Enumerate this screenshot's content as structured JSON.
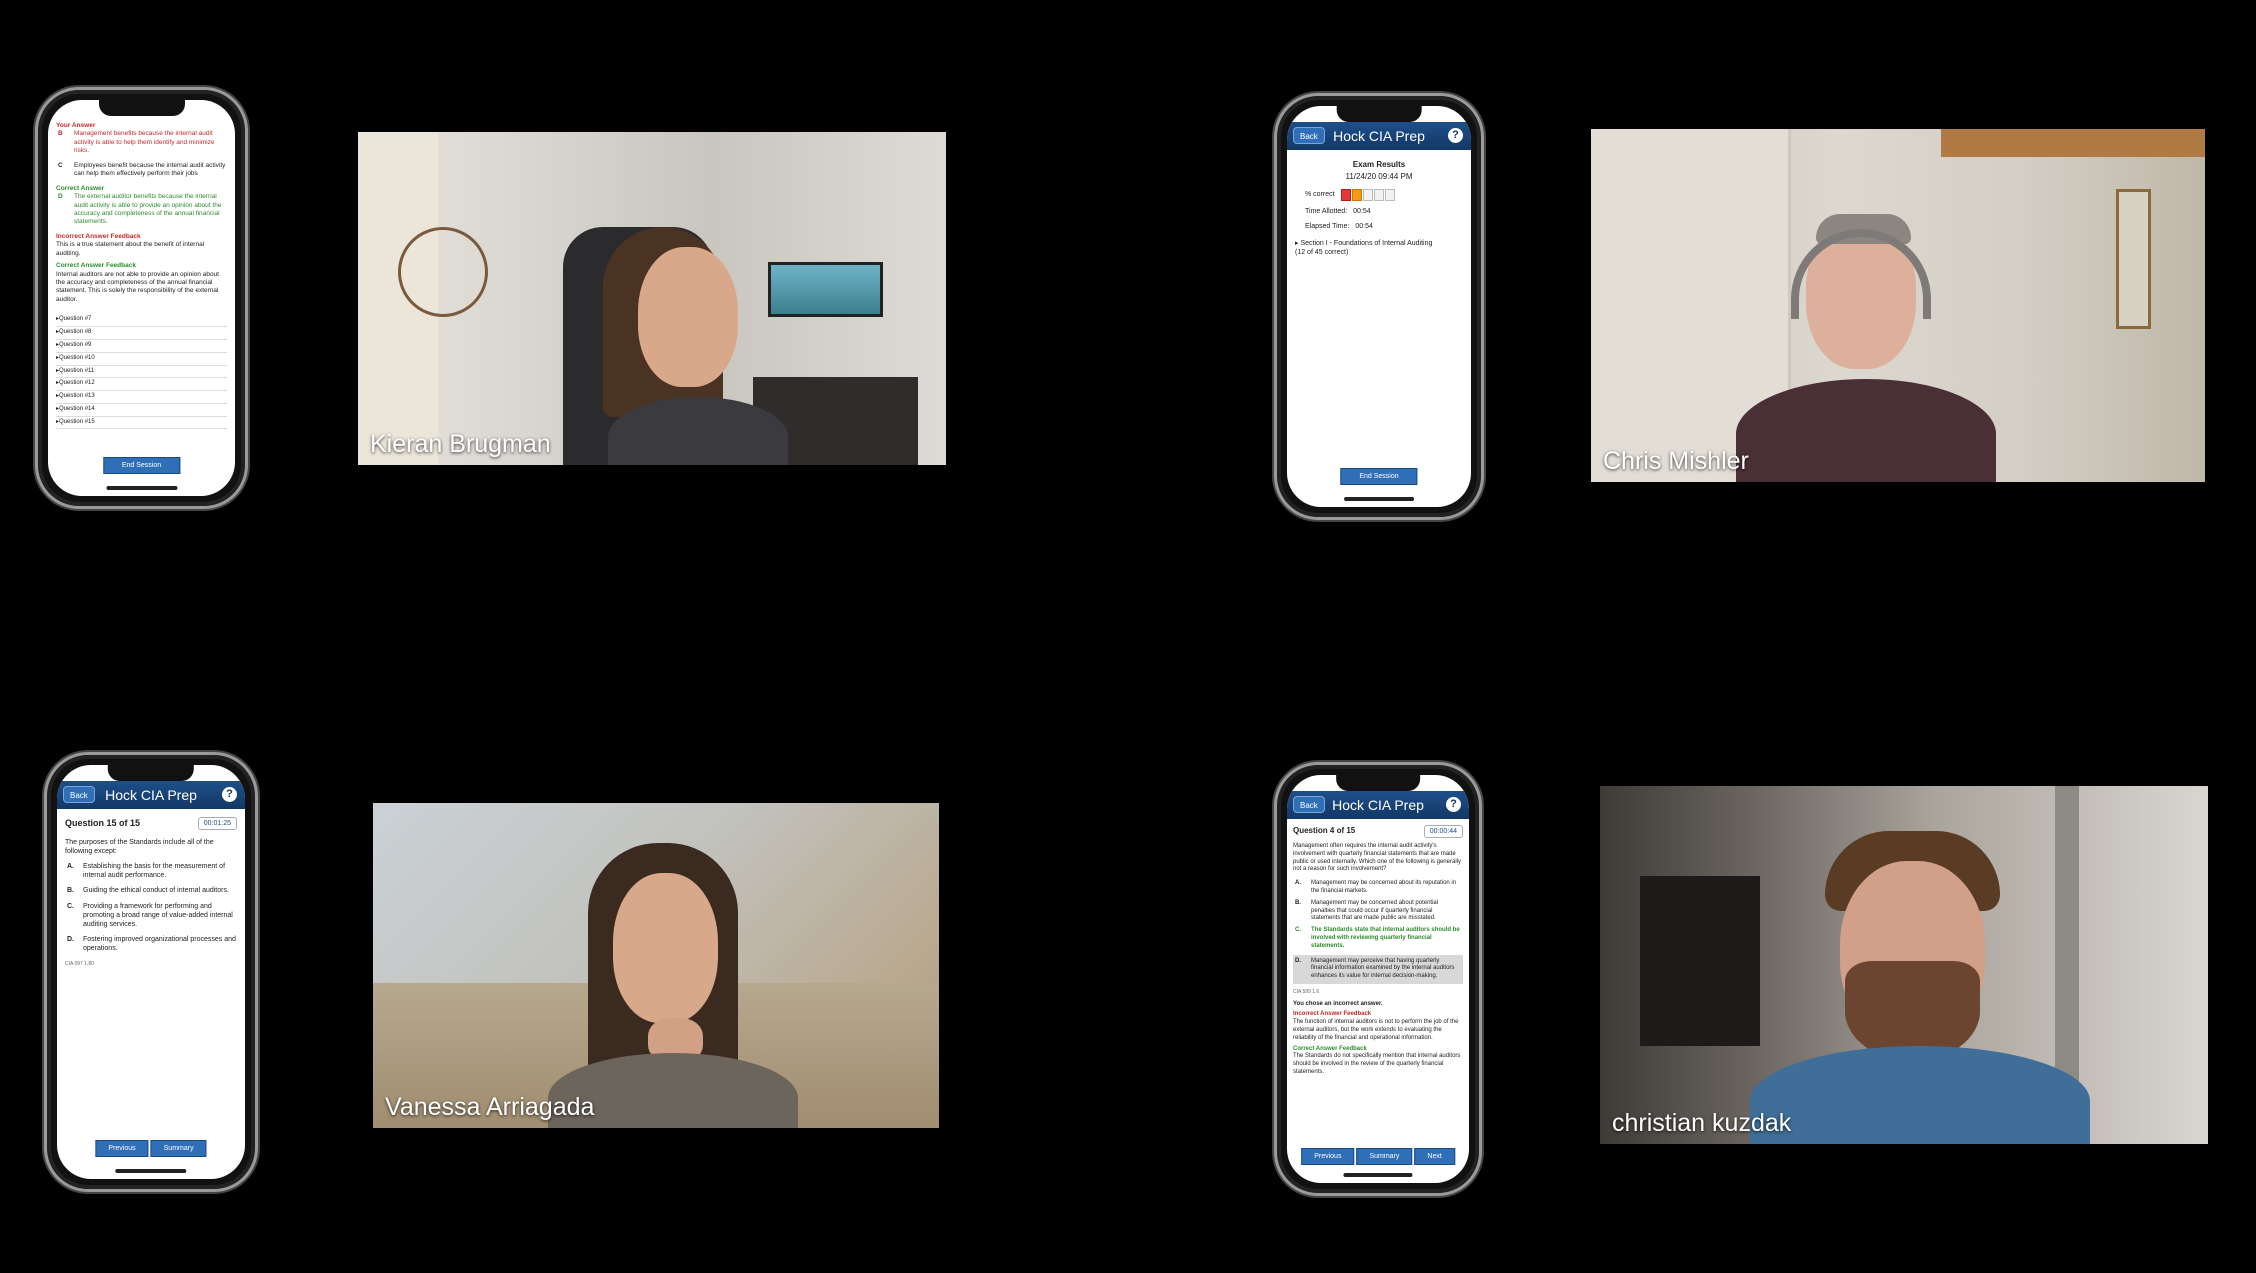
{
  "tiles": [
    {
      "name": "Kieran Brugman"
    },
    {
      "name": "Chris Mishler"
    },
    {
      "name": "Vanessa Arriagada"
    },
    {
      "name": "christian kuzdak"
    }
  ],
  "phone1": {
    "your_answer_label": "Your Answer",
    "your_answer_letter": "B",
    "your_answer_text": "Management benefits because the internal audit activity is able to help them identify and minimize risks.",
    "opt_c_letter": "C",
    "opt_c_text": "Employees benefit because the internal audit activity can help them effectively perform their jobs",
    "correct_answer_label": "Correct Answer",
    "correct_letter": "D",
    "correct_text": "The external auditor benefits because the internal audit activity is able to provide an opinion about the accuracy and completeness of the annual financial statements.",
    "incorrect_feedback_label": "Incorrect Answer Feedback",
    "incorrect_feedback_text": "This is a true statement about the benefit of internal auditing.",
    "correct_feedback_label": "Correct Answer Feedback",
    "correct_feedback_text": "Internal auditors are not able to provide an opinion about the accuracy and completeness of the annual financial statement. This is solely the responsibility of the external auditor.",
    "questions": [
      "Question #7",
      "Question #8",
      "Question #9",
      "Question #10",
      "Question #11",
      "Question #12",
      "Question #13",
      "Question #14",
      "Question #15"
    ],
    "end_button": "End Session"
  },
  "phone2": {
    "back": "Back",
    "title": "Hock CIA Prep",
    "help": "?",
    "results_title": "Exam Results",
    "results_date": "11/24/20 09:44 PM",
    "pct_label": "% correct",
    "pct_value": 0.27,
    "time_allotted_label": "Time Allotted:",
    "time_allotted": "00:54",
    "elapsed_label": "Elapsed Time:",
    "elapsed": "00:54",
    "section": "Section I - Foundations of Internal Auditing",
    "section_score": "(12 of 45 correct)",
    "end_button": "End Session"
  },
  "phone3": {
    "back": "Back",
    "title": "Hock CIA Prep",
    "help": "?",
    "question": "Question 15 of 15",
    "timer": "00:01:25",
    "stem": "The purposes of the Standards include all of the following except:",
    "options": [
      {
        "letter": "A.",
        "text": "Establishing the basis for the measurement of internal audit performance."
      },
      {
        "letter": "B.",
        "text": "Guiding the ethical conduct of internal auditors."
      },
      {
        "letter": "C.",
        "text": "Providing a framework for performing and promoting a broad range of value-added internal auditing services."
      },
      {
        "letter": "D.",
        "text": "Fostering improved organizational processes and operations."
      }
    ],
    "code": "CIA 097 1.80",
    "buttons": [
      "Previous",
      "Summary"
    ]
  },
  "phone4": {
    "back": "Back",
    "title": "Hock CIA Prep",
    "help": "?",
    "question": "Question 4 of 15",
    "timer": "00:00:44",
    "stem": "Management often requires the internal audit activity's involvement with quarterly financial statements that are made public or used internally. Which one of the following is generally not a reason for such involvement?",
    "options": [
      {
        "letter": "A.",
        "text": "Management may be concerned about its reputation in the financial markets."
      },
      {
        "letter": "B.",
        "text": "Management may be concerned about potential penalties that could occur if quarterly financial statements that are made public are misstated."
      },
      {
        "letter": "C.",
        "text": "The Standards state that internal auditors should be involved with reviewing quarterly financial statements."
      },
      {
        "letter": "D.",
        "text": "Management may perceive that having quarterly financial information examined by the internal auditors enhances its value for internal decision-making."
      }
    ],
    "code": "CIA 599 1.6",
    "chose_incorrect": "You chose an incorrect answer.",
    "incorrect_feedback_label": "Incorrect Answer Feedback",
    "incorrect_feedback_text": "The function of internal auditors is not to perform the job of the external auditors, but the work extends to evaluating the reliability of the financial and operational information.",
    "correct_feedback_label": "Correct Answer Feedback",
    "correct_feedback_text": "The Standards do not specifically mention that internal auditors should be involved in the review of the quarterly financial statements.",
    "buttons": [
      "Previous",
      "Summary",
      "Next"
    ]
  }
}
